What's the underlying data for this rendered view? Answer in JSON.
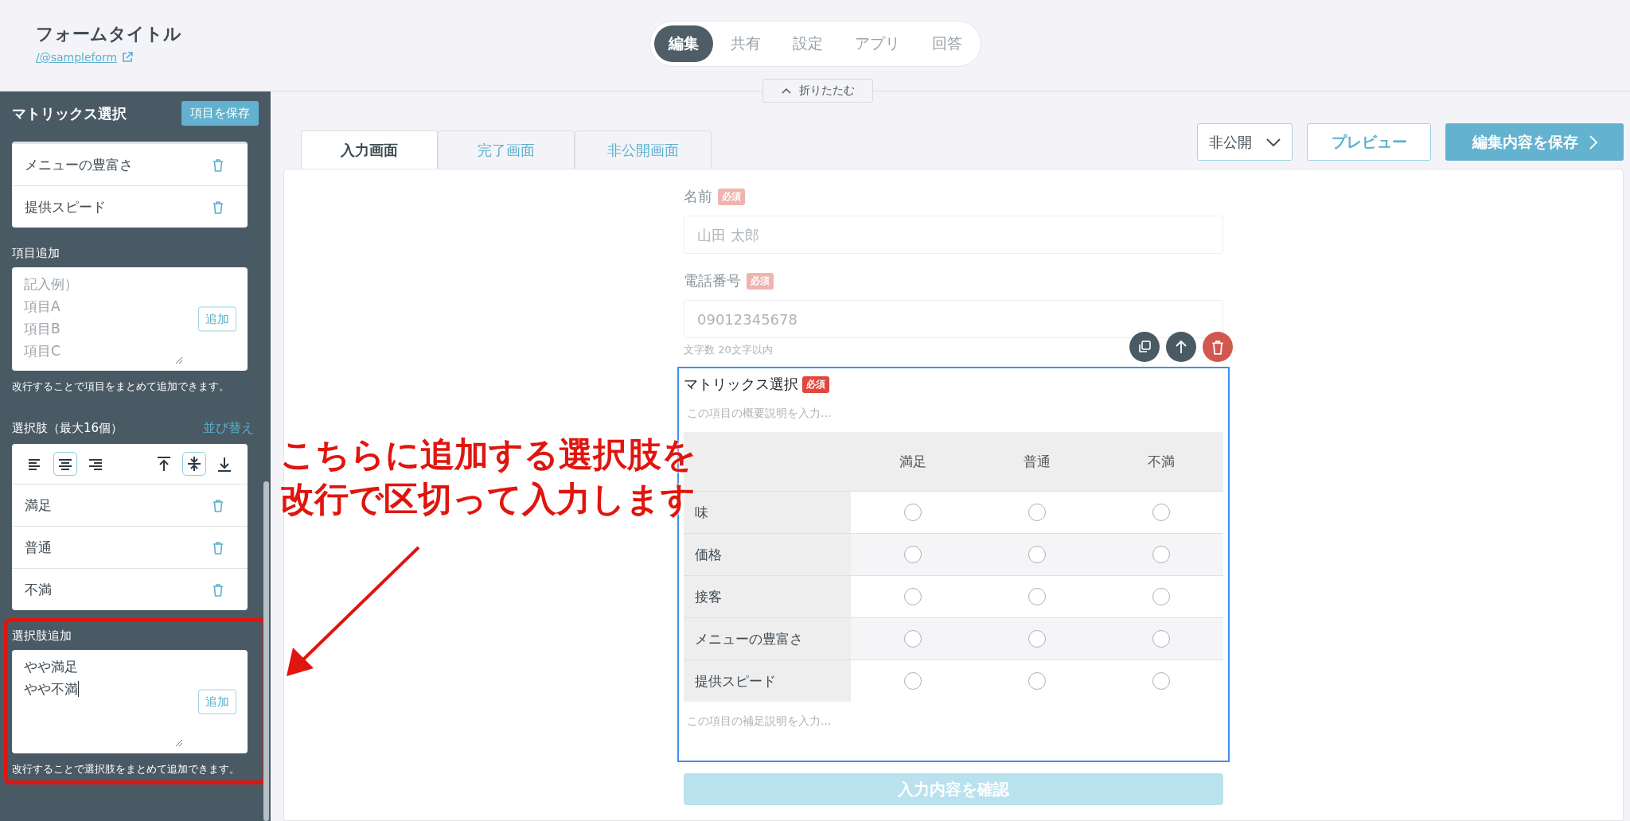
{
  "header": {
    "title": "フォームタイトル",
    "link": "/@sampleform"
  },
  "nav_tabs": [
    {
      "label": "編集",
      "selected": true
    },
    {
      "label": "共有",
      "selected": false
    },
    {
      "label": "設定",
      "selected": false
    },
    {
      "label": "アプリ",
      "selected": false
    },
    {
      "label": "回答",
      "selected": false
    }
  ],
  "collapse": {
    "label": "折りたたむ"
  },
  "sidebar": {
    "title": "マトリックス選択",
    "save_button": "項目を保存",
    "items": [
      "メニューの豊富さ",
      "提供スピード"
    ],
    "add_items": {
      "label": "項目追加",
      "placeholder_lines": [
        "記入例）",
        "項目A",
        "項目B",
        "項目C"
      ],
      "button": "追加",
      "help": "改行することで項目をまとめて追加できます。",
      "highlighted": false
    },
    "choices": {
      "label": "選択肢（最大16個）",
      "sort_link": "並び替え",
      "align_buttons": [
        {
          "kind": "left",
          "selected": false
        },
        {
          "kind": "center",
          "selected": true
        },
        {
          "kind": "right",
          "selected": false
        },
        {
          "kind": "top",
          "selected": false
        },
        {
          "kind": "middle",
          "selected": true
        },
        {
          "kind": "bottom",
          "selected": false
        }
      ],
      "options": [
        "満足",
        "普通",
        "不満"
      ]
    },
    "add_choices": {
      "label": "選択肢追加",
      "value_lines": [
        "やや満足",
        "やや不満"
      ],
      "button": "追加",
      "help": "改行することで選択肢をまとめて追加できます。",
      "highlighted": true
    }
  },
  "screen_tabs": [
    {
      "label": "入力画面",
      "selected": true
    },
    {
      "label": "完了画面",
      "selected": false
    },
    {
      "label": "非公開画面",
      "selected": false
    }
  ],
  "visibility": "非公開",
  "preview_button": "プレビュー",
  "save_button": "編集内容を保存",
  "fields": [
    {
      "label": "名前",
      "badge": "必須",
      "dimmed": true,
      "placeholder": "山田 太郎"
    },
    {
      "label": "電話番号",
      "badge": "必須",
      "dimmed": true,
      "placeholder": "09012345678",
      "hint": "文字数 20文字以内"
    }
  ],
  "matrix": {
    "title": "マトリックス選択",
    "badge": "必須",
    "dimmed": false,
    "description_placeholder": "この項目の概要説明を入力...",
    "columns": [
      "満足",
      "普通",
      "不満"
    ],
    "rows": [
      {
        "label": "味",
        "options": [
          {
            "selected": false
          },
          {
            "selected": false
          },
          {
            "selected": false
          }
        ]
      },
      {
        "label": "価格",
        "options": [
          {
            "selected": false
          },
          {
            "selected": false
          },
          {
            "selected": false
          }
        ]
      },
      {
        "label": "接客",
        "options": [
          {
            "selected": false
          },
          {
            "selected": false
          },
          {
            "selected": false
          }
        ]
      },
      {
        "label": "メニューの豊富さ",
        "options": [
          {
            "selected": false
          },
          {
            "selected": false
          },
          {
            "selected": false
          }
        ]
      },
      {
        "label": "提供スピード",
        "options": [
          {
            "selected": false
          },
          {
            "selected": false
          },
          {
            "selected": false
          }
        ]
      }
    ],
    "note_placeholder": "この項目の補足説明を入力..."
  },
  "confirm_button": "入力内容を確認",
  "annotation": {
    "lines": [
      "こちらに追加する選択肢を",
      "改行で区切って入力します"
    ]
  }
}
